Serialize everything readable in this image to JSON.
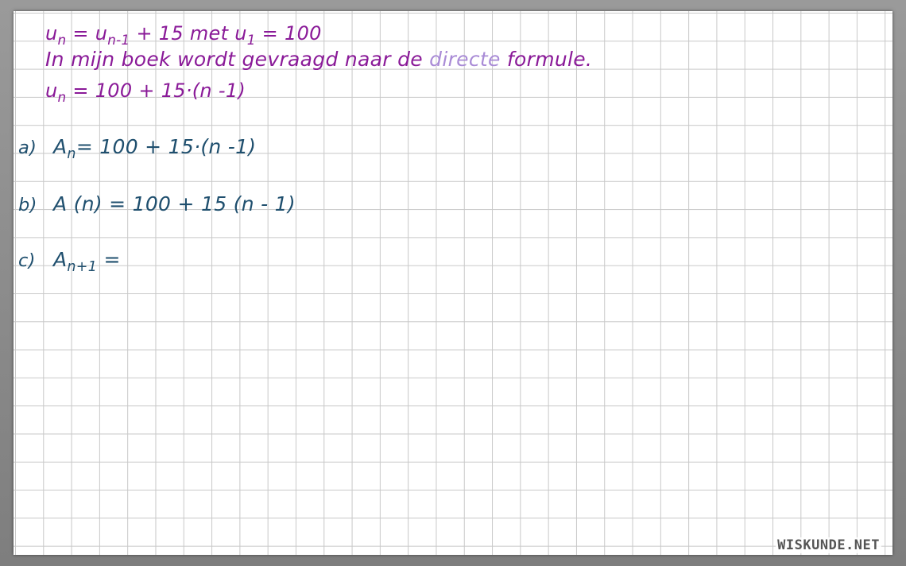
{
  "notes": {
    "line1": {
      "u": "u",
      "n": "n",
      "eq1": " = u",
      "nminus1": "n-1",
      "rest": " + 15   met  u",
      "one": "1",
      "end": " = 100"
    },
    "line2": {
      "before": "In mijn boek wordt gevraagd naar de ",
      "highlight": "directe",
      "after": " formule."
    },
    "line3": {
      "u": "u",
      "n": "n",
      "rest": " = 100 + 15·(n -1)"
    }
  },
  "parts": {
    "a": {
      "label": "a)",
      "A": "A",
      "sub": "n",
      "rest": "= 100 + 15·(n -1)"
    },
    "b": {
      "label": "b)",
      "expr": "A (n) = 100 + 15 (n - 1)"
    },
    "c": {
      "label": "c)",
      "A": "A",
      "sub": "n+1",
      "rest": " ="
    }
  },
  "watermark": "WISKUNDE.NET",
  "colors": {
    "purple_ink": "#8a1a98",
    "lilac_ink": "#a98bd6",
    "teal_ink": "#1f4f6e",
    "grid_line": "#c8c8c8"
  }
}
